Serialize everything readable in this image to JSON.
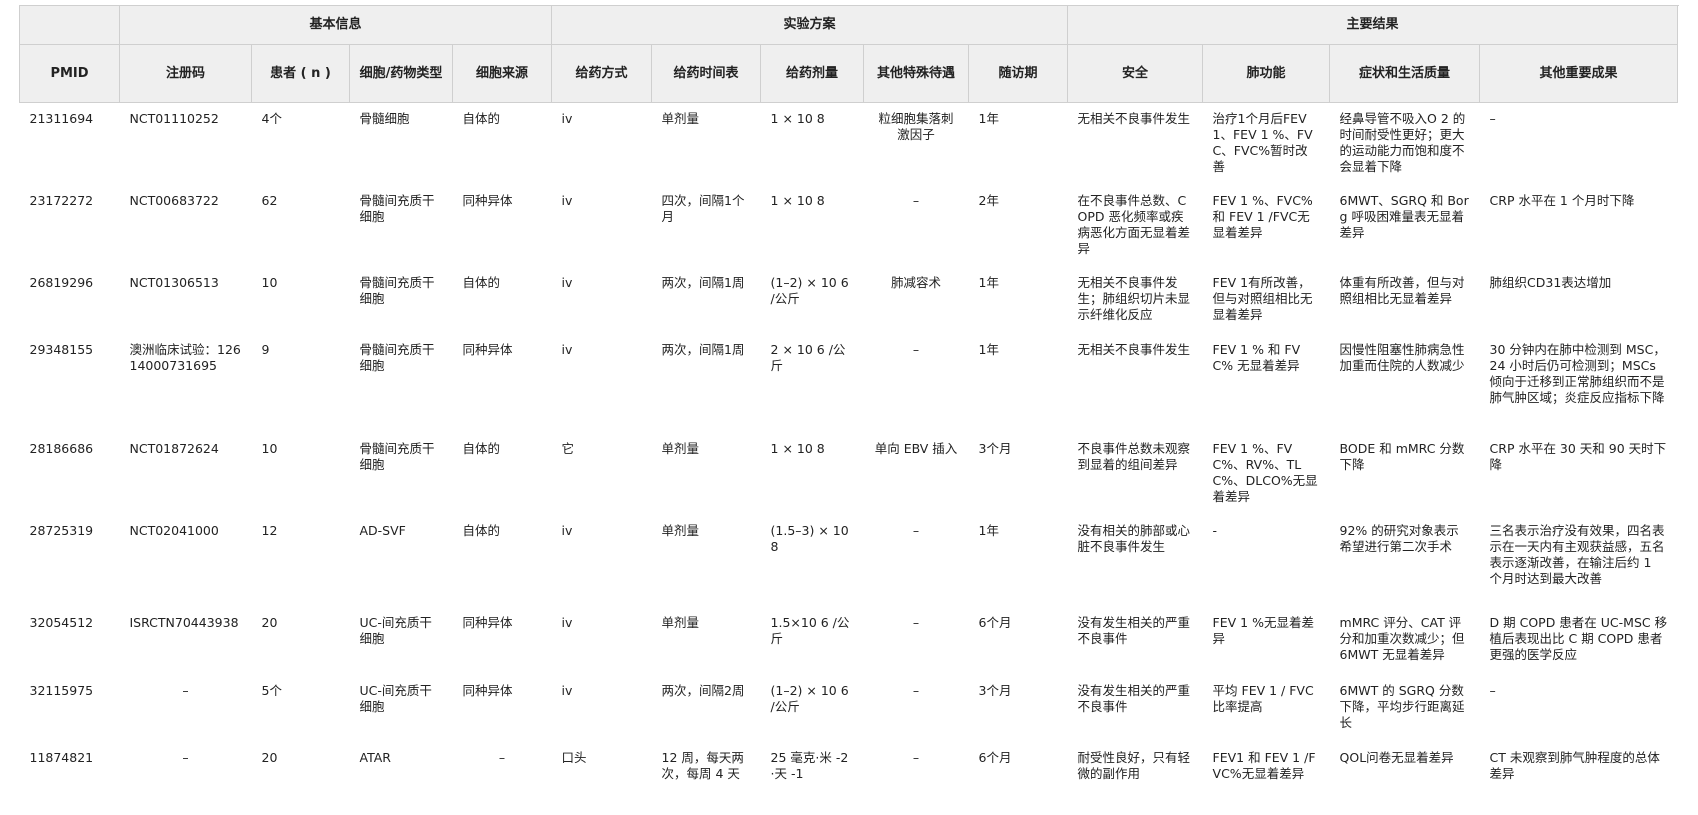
{
  "groups": [
    {
      "label": "",
      "span": 1
    },
    {
      "label": "基本信息",
      "span": 4
    },
    {
      "label": "实验方案",
      "span": 5
    },
    {
      "label": "主要结果",
      "span": 5
    }
  ],
  "columns": [
    "PMID",
    "注册码",
    "患者 ( n )",
    "细胞/药物类型",
    "细胞来源",
    "给药方式",
    "给药时间表",
    "给药剂量",
    "其他特殊待遇",
    "随访期",
    "安全",
    "肺功能",
    "症状和生活质量",
    "其他重要成果"
  ],
  "rows": [
    [
      "21311694",
      "NCT01110252",
      "4个",
      "骨髓细胞",
      "自体的",
      "iv",
      "单剂量",
      "1 × 10 8",
      "粒细胞集落刺激因子",
      "1年",
      "无相关不良事件发生",
      "治疗1个月后FEV 1、FEV 1 %、FVC、FVC%暂时改善",
      "经鼻导管不吸入O 2 的时间耐受性更好；更大的运动能力而饱和度不会显着下降",
      "–"
    ],
    [
      "23172272",
      "NCT00683722",
      "62",
      "骨髓间充质干细胞",
      "同种异体",
      "iv",
      "四次，间隔1个月",
      "1 × 10 8",
      "–",
      "2年",
      "在不良事件总数、COPD 恶化频率或疾病恶化方面无显着差异",
      "FEV 1 %、FVC% 和 FEV 1 /FVC无显着差异",
      "6MWT、SGRQ 和 Borg 呼吸困难量表无显着差异",
      "CRP 水平在 1 个月时下降"
    ],
    [
      "26819296",
      "NCT01306513",
      "10",
      "骨髓间充质干细胞",
      "自体的",
      "iv",
      "两次，间隔1周",
      "(1–2) × 10 6 /公斤",
      "肺减容术",
      "1年",
      "无相关不良事件发生；肺组织切片未显示纤维化反应",
      "FEV 1有所改善，但与对照组相比无显着差异",
      "体重有所改善，但与对照组相比无显着差异",
      "肺组织CD31表达增加"
    ],
    [
      "29348155",
      "澳洲临床试验：12614000731695",
      "9",
      "骨髓间充质干细胞",
      "同种异体",
      "iv",
      "两次，间隔1周",
      "2 × 10 6 /公斤",
      "–",
      "1年",
      "无相关不良事件发生",
      "FEV 1 % 和 FVC% 无显着差异",
      "因慢性阻塞性肺病急性加重而住院的人数减少",
      "30 分钟内在肺中检测到 MSC，24 小时后仍可检测到；MSCs 倾向于迁移到正常肺组织而不是肺气肿区域；炎症反应指标下降"
    ],
    [
      "28186686",
      "NCT01872624",
      "10",
      "骨髓间充质干细胞",
      "自体的",
      "它",
      "单剂量",
      "1 × 10 8",
      "单向 EBV 插入",
      "3个月",
      "不良事件总数未观察到显着的组间差异",
      "FEV 1 %、FVC%、RV%、TLC%、DLCO%无显着差异",
      "BODE 和 mMRC 分数下降",
      "CRP 水平在 30 天和 90 天时下降"
    ],
    [
      "28725319",
      "NCT02041000",
      "12",
      "AD-SVF",
      "自体的",
      "iv",
      "单剂量",
      "(1.5–3) × 10 8",
      "–",
      "1年",
      "没有相关的肺部或心脏不良事件发生",
      "-",
      "92% 的研究对象表示希望进行第二次手术",
      "三名表示治疗没有效果，四名表示在一天内有主观获益感，五名表示逐渐改善，在输注后约 1 个月时达到最大改善"
    ],
    [
      "32054512",
      "ISRCTN70443938",
      "20",
      "UC-间充质干细胞",
      "同种异体",
      "iv",
      "单剂量",
      "1.5×10 6 /公斤",
      "–",
      "6个月",
      "没有发生相关的严重不良事件",
      "FEV 1 %无显着差异",
      "mMRC 评分、CAT 评分和加重次数减少；但 6MWT 无显着差异",
      "D 期 COPD 患者在 UC-MSC 移植后表现出比 C 期 COPD 患者更强的医学反应"
    ],
    [
      "32115975",
      "–",
      "5个",
      "UC-间充质干细胞",
      "同种异体",
      "iv",
      "两次，间隔2周",
      "(1–2) × 10 6 /公斤",
      "–",
      "3个月",
      "没有发生相关的严重不良事件",
      "平均 FEV 1 / FVC 比率提高",
      "6MWT 的 SGRQ 分数下降，平均步行距离延长",
      "–"
    ],
    [
      "11874821",
      "–",
      "20",
      "ATAR",
      "–",
      "口头",
      "12 周，每天两次，每周 4 天",
      "25 毫克·米 -2 ·天 -1",
      "–",
      "6个月",
      "耐受性良好，只有轻微的副作用",
      "FEV1 和 FEV 1 /FVC%无显着差异",
      "QOL问卷无显着差异",
      "CT 未观察到肺气肿程度的总体差异"
    ]
  ]
}
